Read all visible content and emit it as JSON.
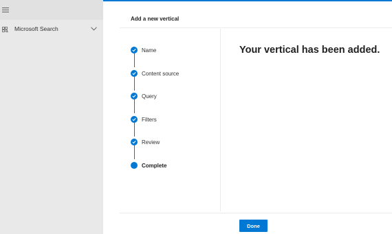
{
  "nav": {
    "menu_icon": "hamburger-icon",
    "items": [
      {
        "label": "Microsoft Search",
        "icon": "search-grid-icon",
        "expand_icon": "chevron-down-icon"
      }
    ]
  },
  "panel": {
    "title": "Add a new vertical",
    "steps": [
      {
        "label": "Name",
        "state": "completed"
      },
      {
        "label": "Content source",
        "state": "completed"
      },
      {
        "label": "Query",
        "state": "completed"
      },
      {
        "label": "Filters",
        "state": "completed"
      },
      {
        "label": "Review",
        "state": "completed"
      },
      {
        "label": "Complete",
        "state": "current"
      }
    ],
    "message": "Your vertical has been added.",
    "done_label": "Done"
  },
  "colors": {
    "accent": "#0078d4",
    "nav_bg": "#e9e9e9"
  }
}
